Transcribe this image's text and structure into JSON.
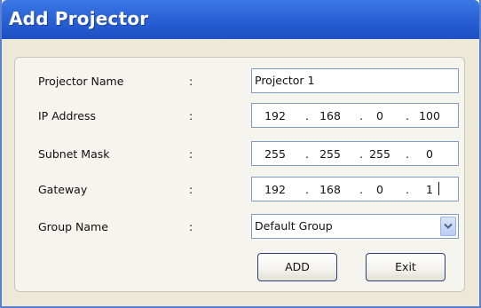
{
  "window": {
    "title": "Add Projector"
  },
  "form": {
    "projector_name": {
      "label": "Projector Name",
      "separator": ":",
      "value": "Projector 1"
    },
    "ip_address": {
      "label": "IP Address",
      "separator": ":",
      "octets": [
        "192",
        "168",
        "0",
        "100"
      ],
      "dot": "."
    },
    "subnet_mask": {
      "label": "Subnet Mask",
      "separator": ":",
      "octets": [
        "255",
        "255",
        "255",
        "0"
      ],
      "dot": "."
    },
    "gateway": {
      "label": "Gateway",
      "separator": ":",
      "octets": [
        "192",
        "168",
        "0",
        "1"
      ],
      "dot": "."
    },
    "group_name": {
      "label": "Group Name",
      "separator": ":",
      "selected": "Default Group",
      "icon": "chevron-down-icon"
    }
  },
  "buttons": {
    "add_label": "ADD",
    "exit_label": "Exit"
  },
  "colors": {
    "title_bar": "#2459cf",
    "window_bg": "#ece9d8",
    "field_border": "#7f9db9",
    "button_border": "#2d3f7a"
  }
}
